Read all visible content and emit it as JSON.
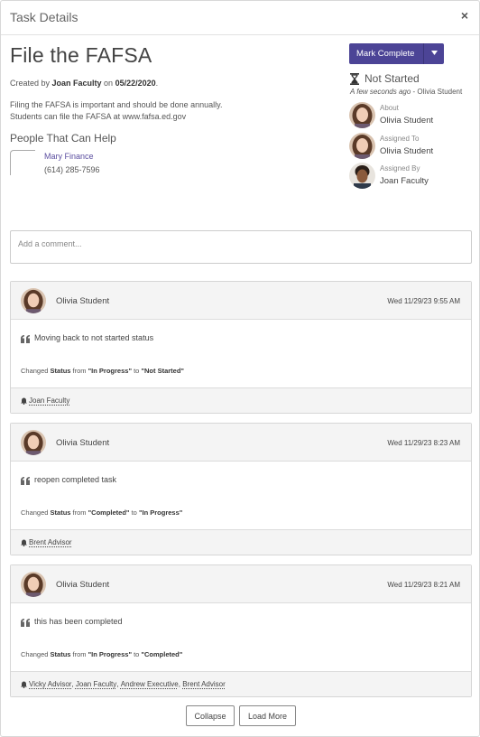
{
  "header": {
    "title": "Task Details",
    "close_symbol": "×"
  },
  "task": {
    "title": "File the FAFSA",
    "created_prefix": "Created by ",
    "created_by": "Joan Faculty",
    "created_on_word": " on ",
    "created_date": "05/22/2020",
    "created_suffix": ".",
    "description_lines": [
      "Filing the FAFSA is important and should be done annually.",
      "Students can file the FAFSA at www.fafsa.ed.gov"
    ]
  },
  "people_help": {
    "title": "People That Can Help",
    "name": "Mary Finance",
    "phone": "(614) 285-7596"
  },
  "actions": {
    "mark_complete_label": "Mark Complete"
  },
  "status": {
    "label": "Not Started",
    "time": "A few seconds ago",
    "separator": " - ",
    "by": "Olivia Student"
  },
  "people": [
    {
      "role": "About",
      "name": "Olivia Student",
      "avatar": "female"
    },
    {
      "role": "Assigned To",
      "name": "Olivia Student",
      "avatar": "female"
    },
    {
      "role": "Assigned By",
      "name": "Joan Faculty",
      "avatar": "male"
    }
  ],
  "comment": {
    "placeholder": "Add a comment..."
  },
  "history": [
    {
      "author": "Olivia Student",
      "date": "Wed 11/29/23 9:55 AM",
      "text": "Moving back to not started status",
      "change": {
        "prefix": "Changed ",
        "field": "Status",
        "from_word": " from ",
        "from": "\"In Progress\"",
        "to_word": " to ",
        "to": "\"Not Started\""
      },
      "notified": [
        "Joan Faculty"
      ]
    },
    {
      "author": "Olivia Student",
      "date": "Wed 11/29/23 8:23 AM",
      "text": "reopen completed task",
      "change": {
        "prefix": "Changed ",
        "field": "Status",
        "from_word": " from ",
        "from": "\"Completed\"",
        "to_word": " to ",
        "to": "\"In Progress\""
      },
      "notified": [
        "Brent Advisor"
      ]
    },
    {
      "author": "Olivia Student",
      "date": "Wed 11/29/23 8:21 AM",
      "text": "this has been completed",
      "change": {
        "prefix": "Changed ",
        "field": "Status",
        "from_word": " from ",
        "from": "\"In Progress\"",
        "to_word": " to ",
        "to": "\"Completed\""
      },
      "notified": [
        "Vicky Advisor",
        "Joan Faculty",
        "Andrew Executive",
        "Brent Advisor"
      ]
    }
  ],
  "footer": {
    "collapse_label": "Collapse",
    "load_more_label": "Load More"
  },
  "colors": {
    "primary": "#4c4496",
    "link": "#5b4ea0"
  },
  "icons": [
    "close-icon",
    "hourglass-icon",
    "quote-icon",
    "bell-icon",
    "chevron-down-icon"
  ]
}
